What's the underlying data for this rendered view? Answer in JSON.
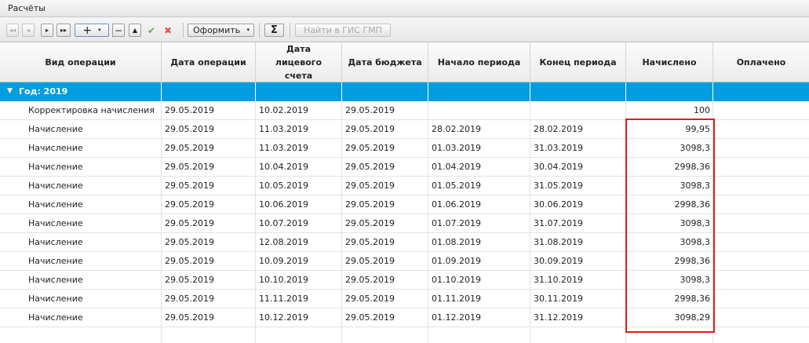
{
  "window": {
    "title": "Расчёты"
  },
  "toolbar": {
    "first_glyph": "◂◂",
    "prev_glyph": "◂",
    "next_glyph": "▸",
    "last_glyph": "▸▸",
    "add_glyph": "+",
    "add_caret": "▾",
    "remove_glyph": "−",
    "up_glyph": "▲",
    "confirm_glyph": "✔",
    "cancel_glyph": "✖",
    "format_label": "Оформить",
    "format_caret": "▾",
    "sum_glyph": "Σ",
    "gis_label": "Найти в ГИС ГМП"
  },
  "grid": {
    "columns": [
      "Вид операции",
      "Дата операции",
      "Дата лицевого счета",
      "Дата бюджета",
      "Начало периода",
      "Конец периода",
      "Начислено",
      "Оплачено"
    ],
    "group": {
      "label": "Год: 2019"
    },
    "rows": [
      [
        "Корректировка начисления",
        "29.05.2019",
        "10.02.2019",
        "29.05.2019",
        "",
        "",
        "100",
        ""
      ],
      [
        "Начисление",
        "29.05.2019",
        "11.03.2019",
        "29.05.2019",
        "28.02.2019",
        "28.02.2019",
        "99,95",
        ""
      ],
      [
        "Начисление",
        "29.05.2019",
        "11.03.2019",
        "29.05.2019",
        "01.03.2019",
        "31.03.2019",
        "3098,3",
        ""
      ],
      [
        "Начисление",
        "29.05.2019",
        "10.04.2019",
        "29.05.2019",
        "01.04.2019",
        "30.04.2019",
        "2998,36",
        ""
      ],
      [
        "Начисление",
        "29.05.2019",
        "10.05.2019",
        "29.05.2019",
        "01.05.2019",
        "31.05.2019",
        "3098,3",
        ""
      ],
      [
        "Начисление",
        "29.05.2019",
        "10.06.2019",
        "29.05.2019",
        "01.06.2019",
        "30.06.2019",
        "2998,36",
        ""
      ],
      [
        "Начисление",
        "29.05.2019",
        "10.07.2019",
        "29.05.2019",
        "01.07.2019",
        "31.07.2019",
        "3098,3",
        ""
      ],
      [
        "Начисление",
        "29.05.2019",
        "12.08.2019",
        "29.05.2019",
        "01.08.2019",
        "31.08.2019",
        "3098,3",
        ""
      ],
      [
        "Начисление",
        "29.05.2019",
        "10.09.2019",
        "29.05.2019",
        "01.09.2019",
        "30.09.2019",
        "2998,36",
        ""
      ],
      [
        "Начисление",
        "29.05.2019",
        "10.10.2019",
        "29.05.2019",
        "01.10.2019",
        "31.10.2019",
        "3098,3",
        ""
      ],
      [
        "Начисление",
        "29.05.2019",
        "11.11.2019",
        "29.05.2019",
        "01.11.2019",
        "30.11.2019",
        "2998,36",
        ""
      ],
      [
        "Начисление",
        "29.05.2019",
        "10.12.2019",
        "29.05.2019",
        "01.12.2019",
        "31.12.2019",
        "3098,29",
        ""
      ]
    ]
  },
  "colors": {
    "group_row_bg": "#019de0",
    "highlight_border": "#e21b1b"
  }
}
